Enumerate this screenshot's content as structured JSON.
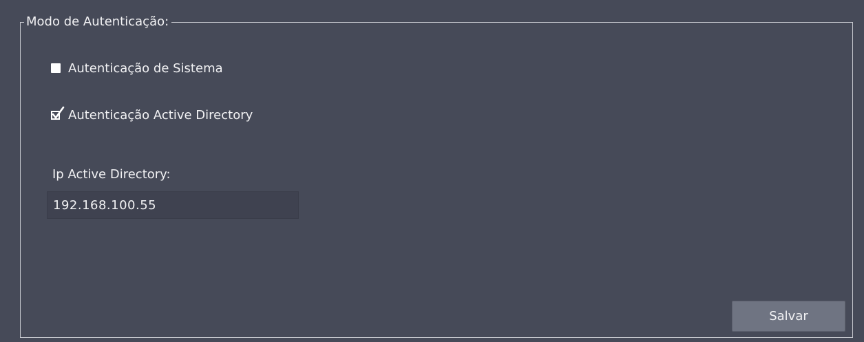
{
  "auth_group": {
    "title": "Modo de Autenticação:",
    "options": [
      {
        "label": "Autenticação de Sistema",
        "checked": false
      },
      {
        "label": "Autenticação Active Directory",
        "checked": true
      }
    ]
  },
  "ip_field": {
    "label": "Ip Active Directory:",
    "value": "192.168.100.55",
    "placeholder": ""
  },
  "actions": {
    "save_label": "Salvar"
  },
  "colors": {
    "background": "#464a58",
    "border": "#c7c9cf",
    "input_background": "#3f4250",
    "button_background": "#6f7482",
    "text": "#f2f2f4"
  }
}
